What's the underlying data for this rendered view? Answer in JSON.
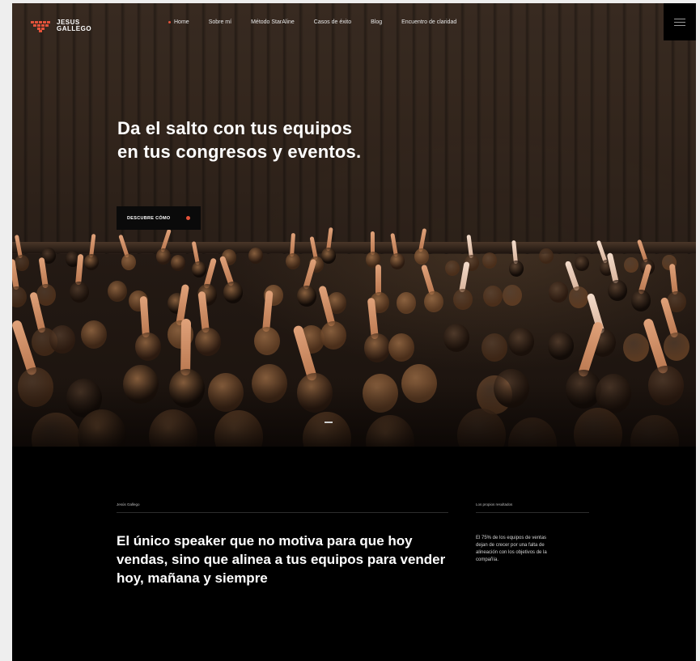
{
  "brand": {
    "line1": "JESUS",
    "line2": "GALLEGO",
    "accent_color": "#e3523a"
  },
  "nav": {
    "items": [
      {
        "label": "Home",
        "active": true
      },
      {
        "label": "Sobre mí",
        "active": false
      },
      {
        "label": "Método StarAline",
        "active": false
      },
      {
        "label": "Casos de éxito",
        "active": false
      },
      {
        "label": "Blog",
        "active": false
      },
      {
        "label": "Encuentro de claridad",
        "active": false
      }
    ],
    "menu_icon": "hamburger-icon"
  },
  "hero": {
    "title": "Da el salto con tus equipos en tus congresos y eventos.",
    "cta_label": "DESCUBRE CÓMO",
    "slide_total": 1
  },
  "intro": {
    "eyebrow_left": "Jesús Gallego",
    "title": "El único speaker que no motiva para que hoy vendas, sino que alinea a tus equipos para vender hoy, mañana y siempre",
    "eyebrow_right": "Los propios resultados",
    "stat_text": "El 75% de los equipos de ventas dejan de crecer por una falta de alineación con los objetivos de la compañía."
  }
}
